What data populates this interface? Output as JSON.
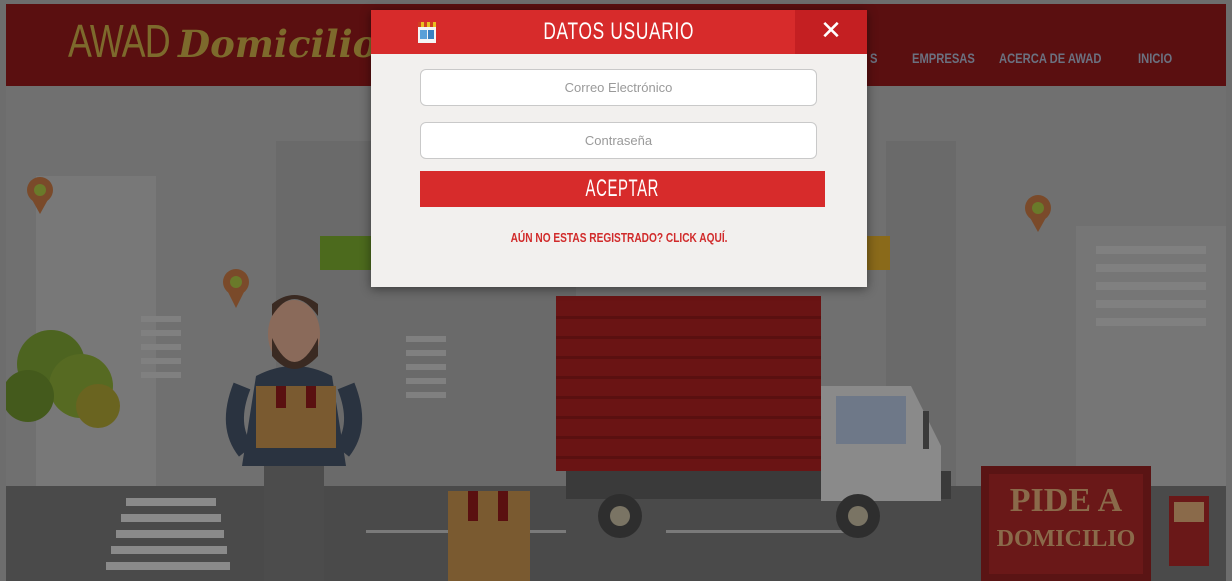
{
  "header": {
    "logo_awad": "AWAD",
    "logo_domicilios": "Domicilios",
    "nav": [
      {
        "label": "S"
      },
      {
        "label": "EMPRESAS"
      },
      {
        "label": "ACERCA DE AWAD"
      },
      {
        "label": "INICIO"
      }
    ]
  },
  "banner": {
    "line1": "PIDE A",
    "line2": "DOMICILIO"
  },
  "modal": {
    "title": "DATOS USUARIO",
    "close_symbol": "✕",
    "email_placeholder": "Correo Electrónico",
    "password_placeholder": "Contraseña",
    "accept_label": "ACEPTAR",
    "register_link": "AÚN NO ESTAS REGISTRADO? CLICK AQUÍ."
  },
  "colors": {
    "header_bg": "#5a0f10",
    "modal_header": "#d72b2b",
    "close_bg": "#c41f22",
    "accent_red": "#d12b2b",
    "overlay": "#6e6e6e"
  },
  "icons": [
    "store-icon",
    "close-icon",
    "map-pin-icon"
  ]
}
